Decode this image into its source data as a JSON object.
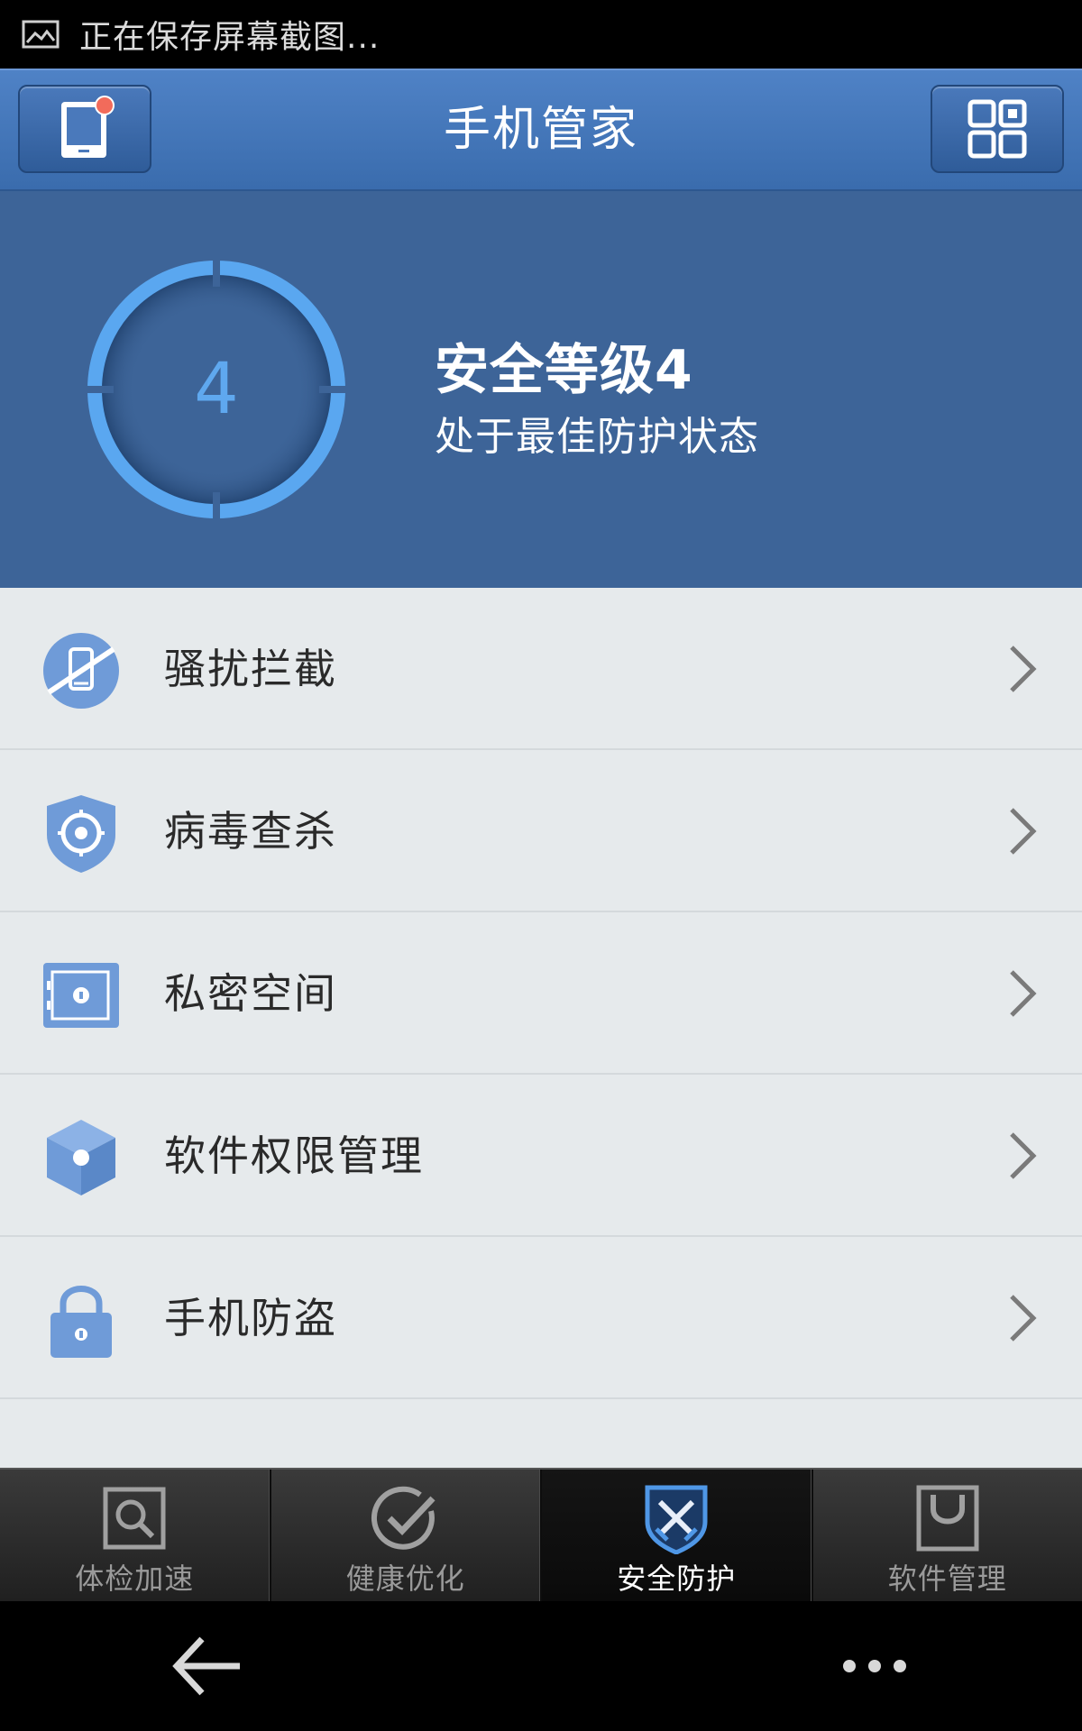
{
  "status_bar": {
    "icon": "image-icon",
    "text": "正在保存屏幕截图..."
  },
  "header": {
    "title": "手机管家",
    "left_button_icon": "phone-notification-icon",
    "right_button_icon": "grid-menu-icon",
    "notification_dot_color": "#f26b5b"
  },
  "security": {
    "level_number": "4",
    "title": "安全等级4",
    "subtitle": "处于最佳防护状态",
    "ring_color": "#5aa7f0",
    "background_color": "#3d6498"
  },
  "menu": [
    {
      "label": "骚扰拦截",
      "icon": "blocked-phone-icon"
    },
    {
      "label": "病毒查杀",
      "icon": "shield-target-icon"
    },
    {
      "label": "私密空间",
      "icon": "safe-box-icon"
    },
    {
      "label": "软件权限管理",
      "icon": "cube-icon"
    },
    {
      "label": "手机防盗",
      "icon": "padlock-icon"
    }
  ],
  "tabs": [
    {
      "label": "体检加速",
      "icon": "magnifier-icon",
      "active": false
    },
    {
      "label": "健康优化",
      "icon": "checkmark-circle-icon",
      "active": false
    },
    {
      "label": "安全防护",
      "icon": "security-shield-icon",
      "active": true
    },
    {
      "label": "软件管理",
      "icon": "shopping-bag-icon",
      "active": false
    }
  ],
  "navbar": {
    "back_icon": "back-arrow-icon",
    "more_icon": "more-dots-icon"
  }
}
